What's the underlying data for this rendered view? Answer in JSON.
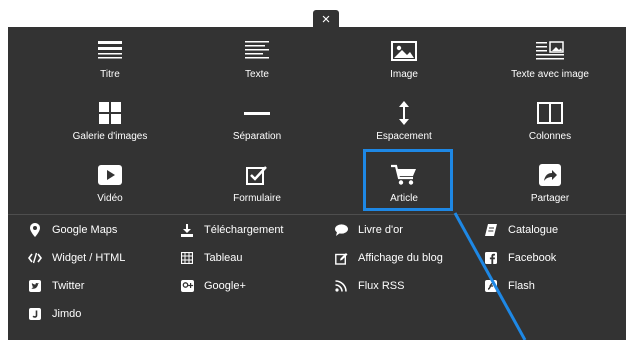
{
  "close_glyph": "×",
  "accent_color": "#1e88e5",
  "panel_color": "#333333",
  "grid": {
    "titre": "Titre",
    "texte": "Texte",
    "image": "Image",
    "texte_image": "Texte avec image",
    "galerie": "Galerie d'images",
    "separation": "Séparation",
    "espacement": "Espacement",
    "colonnes": "Colonnes",
    "video": "Vidéo",
    "formulaire": "Formulaire",
    "article": "Article",
    "partager": "Partager"
  },
  "list": {
    "google_maps": "Google Maps",
    "telechargement": "Téléchargement",
    "livre_dor": "Livre d'or",
    "catalogue": "Catalogue",
    "widget_html": "Widget / HTML",
    "tableau": "Tableau",
    "affichage_blog": "Affichage du blog",
    "facebook": "Facebook",
    "twitter": "Twitter",
    "google_plus": "Google+",
    "flux_rss": "Flux RSS",
    "flash": "Flash",
    "jimdo": "Jimdo"
  }
}
